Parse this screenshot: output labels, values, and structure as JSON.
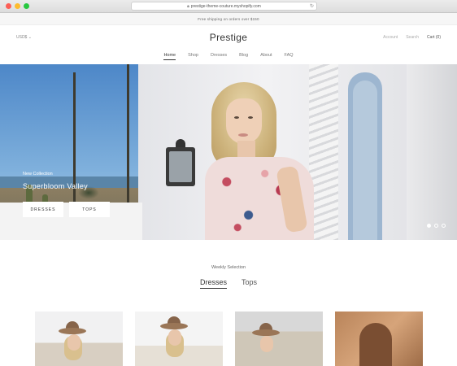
{
  "browser": {
    "url": "prestige-theme-couture.myshopify.com"
  },
  "announcement": {
    "text": "Free shipping on orders over $150"
  },
  "header": {
    "currency": "USD$ ⌄",
    "logo": "Prestige",
    "account": "Account",
    "search": "Search",
    "cart": "Cart (0)"
  },
  "nav": {
    "items": [
      {
        "label": "Home",
        "active": true
      },
      {
        "label": "Shop"
      },
      {
        "label": "Dresses"
      },
      {
        "label": "Blog"
      },
      {
        "label": "About"
      },
      {
        "label": "FAQ"
      }
    ]
  },
  "hero": {
    "eyebrow": "New Collection",
    "title": "Superbloom Valley",
    "buttons": [
      "DRESSES",
      "TOPS"
    ],
    "slide_count": 3,
    "active_slide": 1
  },
  "weekly": {
    "label": "Weekly Selection",
    "tabs": [
      {
        "label": "Dresses",
        "active": true
      },
      {
        "label": "Tops"
      }
    ]
  },
  "colors": {
    "accent": "#333333",
    "background": "#ffffff"
  }
}
